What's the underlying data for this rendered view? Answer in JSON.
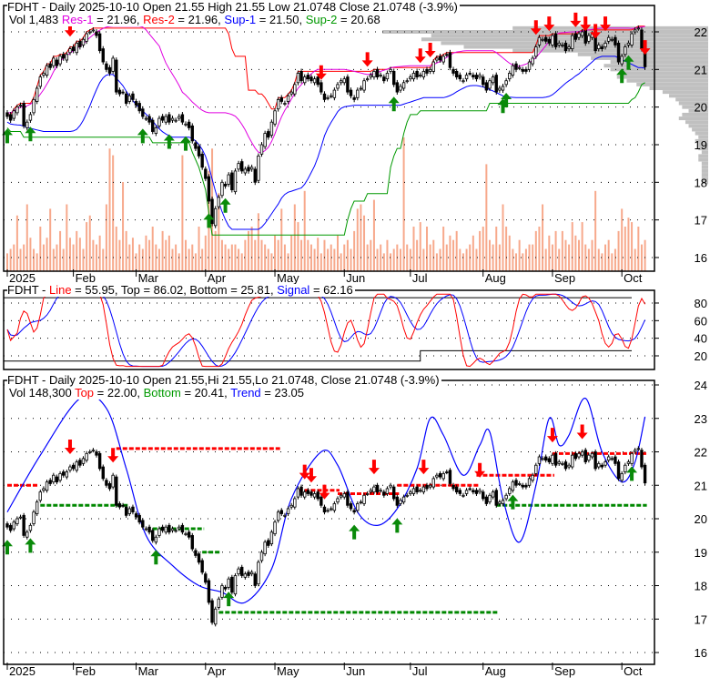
{
  "colors": {
    "res1": "#e000e0",
    "res2": "#ff0000",
    "sup1": "#0000ff",
    "sup2": "#009900",
    "volume": "#f7a98c",
    "profile": "#c0c0c0",
    "line": "#ff0000",
    "signal": "#0000ff"
  },
  "panel1": {
    "line1": {
      "title": "FDHT - Daily 2025-10-10",
      "open": "Open 21.55",
      "high": "High 21.55",
      "low": "Low 21.0748",
      "close": "Close 21.0748 (-3.9%)"
    },
    "line2": {
      "vol": "Vol 1,483",
      "res1_label": "Res-1",
      "res1_value": " = 21.96,",
      "res2_label": "Res-2",
      "res2_value": " = 21.96,",
      "sup1_label": "Sup-1",
      "sup1_value": " = 21.50,",
      "sup2_label": "Sup-2",
      "sup2_value": " = 20.68"
    }
  },
  "panel2": {
    "prefix": "FDHT - ",
    "line_label": "Line",
    "line_value": " = 55.95, Top = 86.02, Bottom = 25.81, ",
    "signal_label": "Signal",
    "signal_value": " = 62.16"
  },
  "panel3": {
    "line1": "FDHT - Daily 2025-10-10 Open 21.55,Hi 21.55,Lo 21.0748, Close 21.0748 (-3.9%)",
    "line2": {
      "vol": "Vol 148,300",
      "top_label": "Top",
      "top_value": " = 22.00,",
      "bottom_label": "Bottom",
      "bottom_value": " = 20.41,",
      "trend_label": "Trend",
      "trend_value": " = 23.05"
    }
  },
  "chart_data": {
    "type": "candlestick",
    "ticker": "FDHT",
    "x_labels": [
      {
        "label": "2025",
        "bar": 0
      },
      {
        "label": "Feb",
        "bar": 20
      },
      {
        "label": "Mar",
        "bar": 39
      },
      {
        "label": "Apr",
        "bar": 60
      },
      {
        "label": "May",
        "bar": 81
      },
      {
        "label": "Jun",
        "bar": 102
      },
      {
        "label": "Jul",
        "bar": 122
      },
      {
        "label": "Aug",
        "bar": 144
      },
      {
        "label": "Sep",
        "bar": 165
      },
      {
        "label": "Oct",
        "bar": 186
      }
    ],
    "price_ticks": [
      16,
      17,
      18,
      19,
      20,
      21,
      22
    ],
    "price_range": [
      15.65,
      22.85
    ],
    "osc_ticks": [
      20,
      40,
      60,
      80
    ],
    "osc_range": [
      4.5,
      94.5
    ],
    "trend_ticks": [
      16,
      17,
      18,
      19,
      20,
      21,
      22,
      23,
      24
    ],
    "trend_range": [
      15.65,
      24.35
    ],
    "close": [
      19.75,
      19.65,
      19.9,
      20.0,
      20.05,
      19.5,
      19.6,
      19.8,
      20.2,
      20.5,
      20.8,
      20.9,
      21.1,
      21.05,
      21.3,
      21.1,
      21.35,
      21.3,
      21.4,
      21.55,
      21.5,
      21.7,
      21.6,
      21.8,
      21.95,
      22.0,
      22.05,
      21.9,
      21.5,
      21.2,
      21.0,
      20.9,
      21.3,
      20.4,
      20.35,
      20.4,
      20.1,
      20.3,
      20.2,
      20.05,
      19.9,
      19.75,
      19.7,
      19.6,
      19.35,
      19.45,
      19.7,
      19.65,
      19.75,
      19.6,
      19.7,
      19.65,
      19.75,
      19.6,
      19.55,
      19.45,
      19.1,
      18.9,
      18.7,
      18.4,
      18.1,
      17.5,
      16.9,
      17.3,
      17.6,
      18.0,
      17.9,
      18.2,
      17.8,
      18.3,
      18.5,
      18.3,
      18.35,
      18.3,
      18.4,
      18.0,
      18.7,
      19.0,
      19.3,
      19.2,
      19.6,
      19.9,
      20.2,
      20.15,
      20.1,
      20.3,
      20.4,
      20.6,
      20.9,
      20.7,
      20.8,
      20.75,
      20.7,
      20.75,
      20.6,
      20.4,
      20.2,
      20.25,
      20.3,
      20.45,
      20.6,
      20.7,
      20.75,
      20.4,
      20.3,
      20.2,
      20.45,
      20.5,
      20.7,
      20.75,
      20.85,
      20.95,
      20.8,
      20.85,
      20.7,
      20.9,
      21.0,
      20.6,
      20.4,
      20.55,
      20.65,
      20.7,
      20.8,
      20.9,
      20.8,
      20.85,
      20.95,
      20.9,
      21.0,
      21.2,
      21.3,
      21.25,
      21.35,
      21.4,
      21.05,
      20.9,
      20.8,
      20.75,
      20.7,
      20.85,
      20.9,
      20.8,
      20.75,
      20.85,
      20.6,
      20.45,
      20.7,
      20.8,
      20.4,
      20.5,
      20.55,
      20.7,
      20.9,
      21.1,
      21.0,
      21.05,
      20.95,
      20.95,
      21.2,
      21.3,
      21.6,
      21.85,
      21.8,
      21.75,
      21.7,
      21.9,
      21.6,
      21.7,
      21.65,
      21.5,
      21.6,
      21.9,
      21.8,
      21.95,
      22.0,
      21.7,
      21.9,
      21.95,
      21.5,
      21.65,
      21.55,
      21.7,
      21.85,
      21.8,
      21.65,
      21.2,
      21.35,
      21.6,
      21.7,
      21.95,
      22.05,
      22.1,
      21.55,
      21.07
    ],
    "volume_relative": [
      8,
      10,
      12,
      25,
      10,
      12,
      30,
      15,
      10,
      8,
      20,
      12,
      15,
      28,
      10,
      12,
      18,
      10,
      30,
      15,
      12,
      18,
      15,
      10,
      22,
      25,
      14,
      12,
      16,
      10,
      30,
      55,
      52,
      20,
      14,
      40,
      18,
      12,
      15,
      8,
      12,
      10,
      16,
      14,
      20,
      12,
      10,
      18,
      14,
      16,
      10,
      12,
      8,
      52,
      14,
      10,
      12,
      8,
      20,
      10,
      16,
      45,
      55,
      18,
      35,
      14,
      12,
      10,
      12,
      12,
      10,
      8,
      14,
      18,
      20,
      14,
      26,
      14,
      12,
      10,
      8,
      16,
      14,
      28,
      12,
      8,
      16,
      30,
      22,
      14,
      36,
      14,
      12,
      10,
      15,
      8,
      14,
      10,
      12,
      10,
      16,
      8,
      12,
      14,
      10,
      18,
      28,
      30,
      25,
      12,
      14,
      32,
      10,
      12,
      8,
      14,
      8,
      10,
      12,
      10,
      60,
      12,
      10,
      20,
      14,
      22,
      10,
      20,
      12,
      14,
      8,
      10,
      20,
      12,
      16,
      14,
      18,
      10,
      8,
      10,
      12,
      16,
      10,
      18,
      20,
      48,
      14,
      12,
      20,
      12,
      30,
      20,
      16,
      10,
      8,
      14,
      8,
      10,
      12,
      12,
      18,
      20,
      30,
      10,
      16,
      12,
      18,
      10,
      18,
      14,
      12,
      22,
      16,
      14,
      22,
      12,
      10,
      14,
      36,
      10,
      8,
      12,
      14,
      8,
      10,
      18,
      28,
      20,
      24,
      22,
      10,
      20,
      12,
      14
    ],
    "volume_profile": [
      [
        22.1,
        60
      ],
      [
        22.0,
        100
      ],
      [
        21.9,
        85
      ],
      [
        21.8,
        88
      ],
      [
        21.7,
        82
      ],
      [
        21.6,
        75
      ],
      [
        21.5,
        60
      ],
      [
        21.4,
        40
      ],
      [
        21.3,
        36
      ],
      [
        21.2,
        30
      ],
      [
        21.1,
        32
      ],
      [
        21.0,
        30
      ],
      [
        20.9,
        27
      ],
      [
        20.8,
        28
      ],
      [
        20.7,
        25
      ],
      [
        20.6,
        22
      ],
      [
        20.5,
        18
      ],
      [
        20.4,
        14
      ],
      [
        20.3,
        12
      ],
      [
        20.2,
        10
      ],
      [
        20.1,
        9
      ],
      [
        20.0,
        8
      ],
      [
        19.9,
        6
      ],
      [
        19.8,
        8
      ],
      [
        19.7,
        9
      ],
      [
        19.6,
        7
      ],
      [
        19.5,
        6
      ],
      [
        19.4,
        5
      ],
      [
        19.3,
        4
      ],
      [
        19.2,
        3
      ],
      [
        19.1,
        4
      ],
      [
        19.0,
        3
      ],
      [
        18.9,
        3
      ],
      [
        18.8,
        2
      ],
      [
        18.7,
        3
      ],
      [
        18.6,
        3
      ],
      [
        18.5,
        2
      ],
      [
        18.4,
        2
      ],
      [
        18.3,
        2
      ],
      [
        18.2,
        2
      ],
      [
        18.1,
        2
      ],
      [
        18.0,
        2
      ]
    ],
    "signals_panel1": {
      "sell": [
        19,
        95,
        109,
        125,
        128,
        160,
        164,
        172,
        175,
        178,
        181,
        193
      ],
      "buy": [
        0,
        7,
        41,
        49,
        54,
        61,
        66,
        117,
        150,
        151,
        186,
        188
      ]
    },
    "signals_panel3": {
      "sell": [
        19,
        32,
        90,
        92,
        96,
        111,
        126,
        143,
        165,
        174
      ],
      "buy": [
        0,
        7,
        45,
        67,
        105,
        118,
        153,
        189
      ]
    },
    "top_segments": [
      [
        0,
        9,
        21.0
      ],
      [
        33,
        82,
        22.1
      ],
      [
        88,
        100,
        20.85
      ],
      [
        100,
        118,
        20.75
      ],
      [
        118,
        142,
        21.0
      ],
      [
        142,
        165,
        21.3
      ],
      [
        165,
        193,
        21.95
      ]
    ],
    "bottom_segments": [
      [
        10,
        36,
        20.4
      ],
      [
        44,
        59,
        19.7
      ],
      [
        59,
        64,
        19.0
      ],
      [
        64,
        148,
        17.2
      ],
      [
        148,
        193,
        20.4
      ]
    ],
    "trend_curve": [
      [
        0,
        20.2
      ],
      [
        10,
        21.9
      ],
      [
        22,
        23.6
      ],
      [
        30,
        23.3
      ],
      [
        36,
        21.5
      ],
      [
        42,
        19.5
      ],
      [
        50,
        18.6
      ],
      [
        58,
        18.0
      ],
      [
        65,
        17.8
      ],
      [
        72,
        17.5
      ],
      [
        80,
        18.5
      ],
      [
        86,
        20.6
      ],
      [
        95,
        22.0
      ],
      [
        100,
        21.6
      ],
      [
        106,
        20.2
      ],
      [
        112,
        19.8
      ],
      [
        118,
        20.3
      ],
      [
        124,
        21.5
      ],
      [
        128,
        23.0
      ],
      [
        132,
        22.5
      ],
      [
        138,
        21.3
      ],
      [
        143,
        22.2
      ],
      [
        146,
        22.6
      ],
      [
        150,
        20.6
      ],
      [
        155,
        19.3
      ],
      [
        160,
        21.0
      ],
      [
        164,
        23.0
      ],
      [
        167,
        22.2
      ],
      [
        170,
        22.5
      ],
      [
        175,
        23.6
      ],
      [
        180,
        22.0
      ],
      [
        186,
        21.1
      ],
      [
        190,
        21.7
      ],
      [
        193,
        23.05
      ]
    ],
    "osc_top": 86.02,
    "osc_bottom": 25.81
  }
}
